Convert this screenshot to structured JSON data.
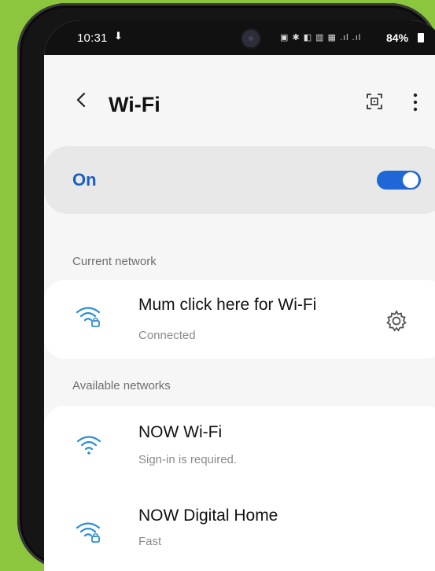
{
  "status_bar": {
    "time": "10:31",
    "download_icon": "download-arrow-icon",
    "indicators": "▣ ✱ ◧ ▥ ▦ .ıl .ıl",
    "battery": "84%"
  },
  "header": {
    "title": "Wi-Fi",
    "back_icon": "chevron-left-icon",
    "qr_icon": "qr-scan-icon",
    "more_icon": "more-vertical-icon"
  },
  "wifi_toggle": {
    "label": "On",
    "state": true,
    "accent": "#1f66d6"
  },
  "current_network": {
    "section_label": "Current network",
    "network": {
      "name": "Mum click here for Wi-Fi",
      "status": "Connected",
      "icon": "wifi-lock-icon",
      "settings_icon": "gear-icon"
    }
  },
  "available_networks": {
    "section_label": "Available networks",
    "networks": [
      {
        "name": "NOW Wi-Fi",
        "status": "Sign-in is required.",
        "icon": "wifi-icon"
      },
      {
        "name": "NOW Digital Home",
        "status": "Fast",
        "icon": "wifi-lock-icon"
      }
    ]
  },
  "colors": {
    "background": "#8cc63f",
    "accent_blue": "#1f66d6",
    "wifi_icon": "#2a8fd8"
  }
}
